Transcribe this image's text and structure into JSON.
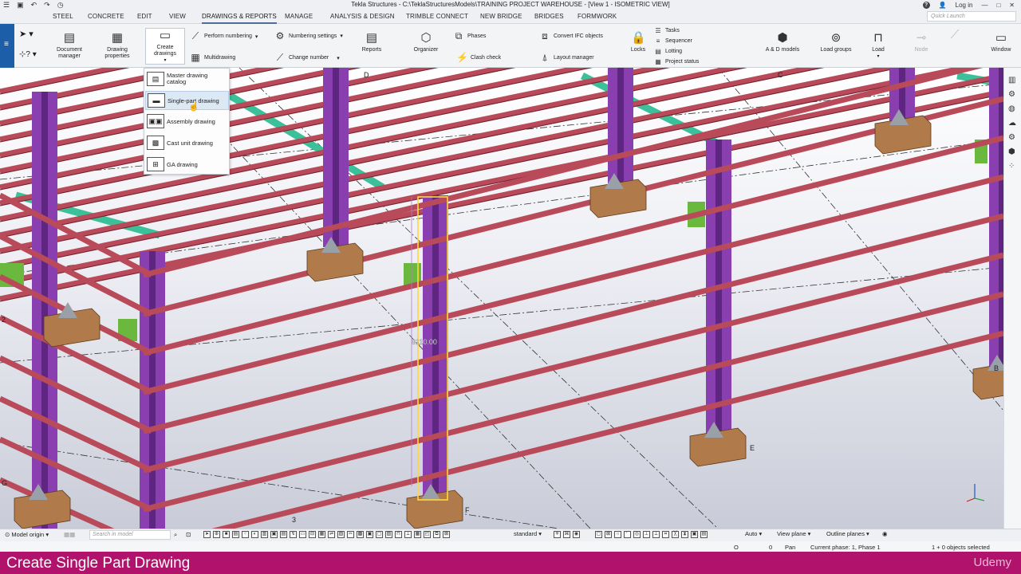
{
  "titlebar": {
    "title": "Tekla Structures - C:\\TeklaStructuresModels\\TRAINING PROJECT WAREHOUSE - [View 1 - ISOMETRIC VIEW]",
    "login": "Log in"
  },
  "menu": {
    "tabs": [
      "STEEL",
      "CONCRETE",
      "EDIT",
      "VIEW",
      "DRAWINGS & REPORTS",
      "MANAGE",
      "ANALYSIS & DESIGN",
      "TRIMBLE CONNECT",
      "NEW BRIDGE",
      "BRIDGES",
      "FORMWORK"
    ],
    "active": "DRAWINGS & REPORTS",
    "quick_launch_placeholder": "Quick Launch"
  },
  "ribbon": {
    "document_manager": "Document manager",
    "drawing_properties": "Drawing properties",
    "create_drawings": "Create drawings",
    "perform_numbering": "Perform numbering",
    "multidrawing": "Multidrawing",
    "numbering_settings": "Numbering settings",
    "change_number": "Change number",
    "reports": "Reports",
    "organizer": "Organizer",
    "phases": "Phases",
    "clash_check": "Clash check",
    "convert_ifc": "Convert IFC objects",
    "layout_manager": "Layout manager",
    "locks": "Locks",
    "tasks": "Tasks",
    "sequencer": "Sequencer",
    "lotting": "Lotting",
    "project_status": "Project status",
    "ad_models": "A & D models",
    "load_groups": "Load groups",
    "load": "Load",
    "node": "Node",
    "window": "Window"
  },
  "dropdown": {
    "items": [
      "Master drawing catalog",
      "Single-part drawing",
      "Assembly drawing",
      "Cast unit drawing",
      "GA drawing"
    ],
    "highlighted": "Single-part drawing"
  },
  "viewport": {
    "dimension_label": "9110.00",
    "grid_labels": [
      "D",
      "C",
      "E",
      "F",
      "G",
      "2",
      "3",
      "B"
    ]
  },
  "bottombar": {
    "model_origin": "Model origin",
    "search_placeholder": "Search in model",
    "standard": "standard",
    "auto": "Auto",
    "view_plane": "View plane",
    "outline_planes": "Outline planes"
  },
  "statusbar": {
    "o": "O",
    "zero": "0",
    "pan": "Pan",
    "phase": "Current phase: 1, Phase 1",
    "selected": "1 + 0 objects selected"
  },
  "caption": {
    "text": "Create Single Part Drawing",
    "brand": "Udemy"
  },
  "colors": {
    "beam": "#b84a5a",
    "column": "#8a3fb0",
    "footing": "#b07a4a",
    "brace": "#3cc09a",
    "caption_bg": "#b0126c",
    "accent": "#1c5fa8"
  }
}
